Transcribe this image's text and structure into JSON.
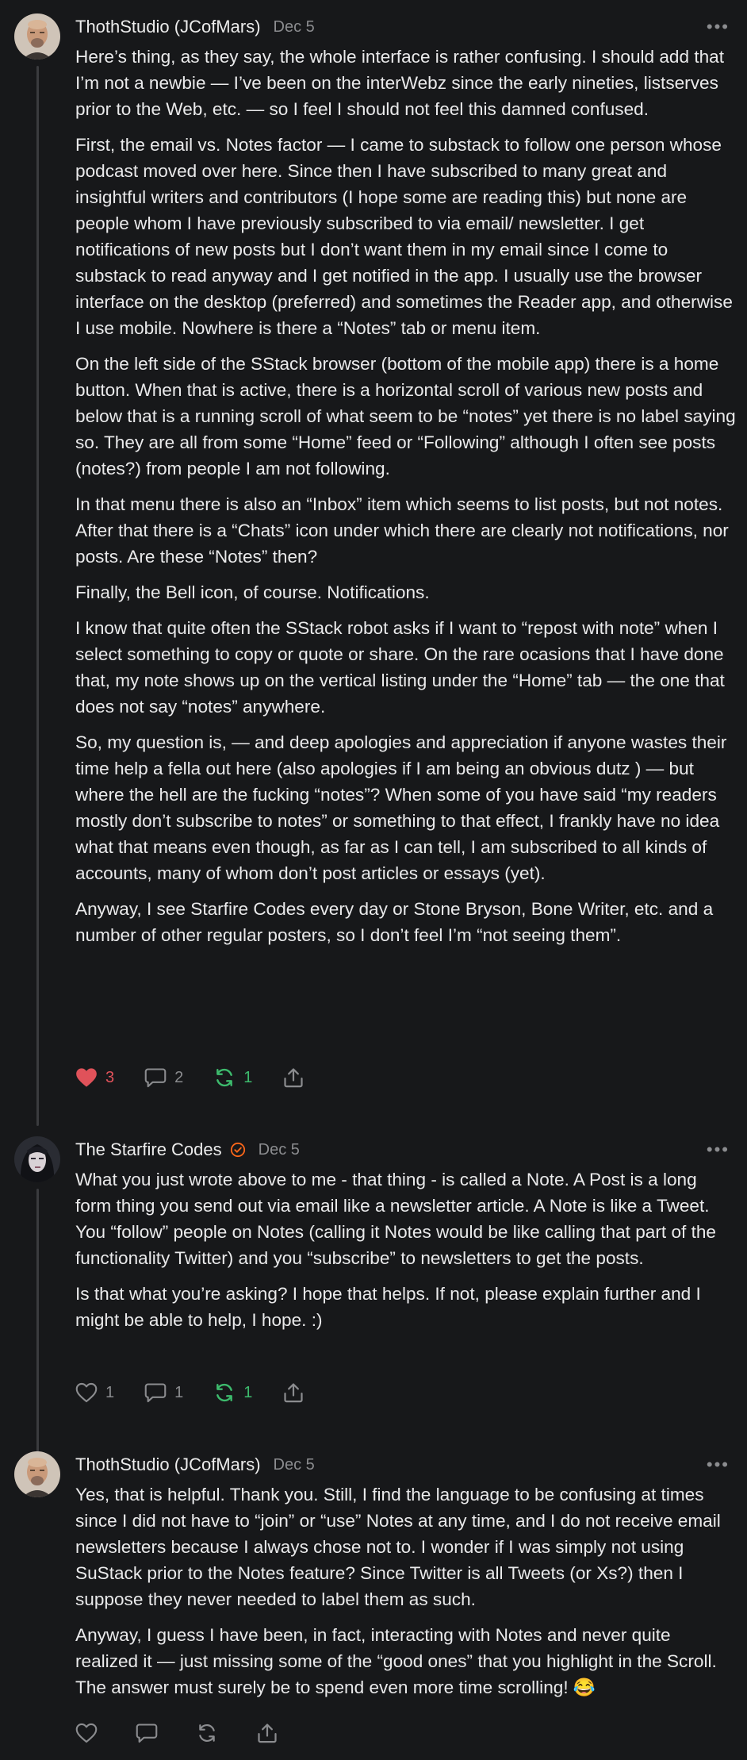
{
  "notes": [
    {
      "author": "ThothStudio (JCofMars)",
      "date": "Dec 5",
      "verified": false,
      "paragraphs": [
        "Here’s thing, as they say, the whole interface is rather confusing. I should add that I’m not a newbie — I’ve been on the interWebz since the early nineties, listserves prior to the Web, etc. — so I feel I should not feel this damned confused.",
        "First, the email vs. Notes factor — I came to substack to follow one person whose podcast moved over here. Since then I have subscribed to many great and insightful writers and contributors (I hope some are reading this) but none are people whom I have previously subscribed to via email/ newsletter. I get notifications of new posts but I don’t want them in my email since I come to substack to read anyway and I get notified in the app. I usually use the browser interface on the desktop (preferred) and sometimes the Reader app, and otherwise I use mobile. Nowhere is there a “Notes” tab or menu item.",
        "On the left side of the SStack browser (bottom of the mobile app) there is a home button. When that is active, there is a horizontal scroll of various new posts and below that is a running scroll of what seem to be “notes” yet there is no label saying so. They are all from some “Home” feed or “Following” although I often see posts (notes?) from people I am not following.",
        "In that menu there is also an “Inbox” item which seems to list posts, but not notes. After that there is a “Chats” icon under which there are clearly not notifications, nor posts. Are these “Notes” then?",
        "Finally, the Bell icon, of course. Notifications.",
        "I know that quite often the SStack robot asks if I want to “repost with note” when I select something to copy or quote or share. On the rare ocasions that I have done that, my note shows up on the vertical listing under the “Home” tab — the one that does not say “notes” anywhere.",
        "So, my question is, — and deep apologies and appreciation if anyone wastes their time help a fella out here (also apologies if I am being an obvious dutz ) — but where the hell are the fucking “notes”? When some of you have said “my readers mostly don’t subscribe to notes” or something to that effect, I frankly have no idea what that means even though, as far as I can tell, I am subscribed to all kinds of accounts, many of whom don’t post articles or essays (yet).",
        "Anyway, I see Starfire Codes every day or Stone Bryson, Bone Writer, etc. and a number of other regular posters, so I don’t feel I’m “not seeing them”."
      ],
      "likes": "3",
      "comments": "2",
      "restacks": "1",
      "liked": true,
      "restacked": true
    },
    {
      "author": "The Starfire Codes",
      "date": "Dec 5",
      "verified": true,
      "paragraphs": [
        "What you just wrote above to me - that thing - is called a Note. A Post is a long form thing you send out via email like a newsletter article. A Note is like a Tweet. You “follow” people on Notes (calling it Notes would be like calling that part of the functionality Twitter) and you “subscribe” to newsletters to get the posts.",
        "Is that what you’re asking? I hope that helps. If not, please explain further and I might be able to help, I hope. :)"
      ],
      "likes": "1",
      "comments": "1",
      "restacks": "1",
      "liked": false,
      "restacked": true
    },
    {
      "author": "ThothStudio (JCofMars)",
      "date": "Dec 5",
      "verified": false,
      "paragraphs": [
        "Yes, that is helpful. Thank you. Still, I find the language to be confusing at times since I did not have to “join” or “use” Notes at any time, and I do not receive email newsletters because I always chose not to. I wonder if I was simply not using SuStack prior to the Notes feature? Since Twitter is all Tweets (or Xs?) then I suppose they never needed to label them as such.",
        "Anyway, I guess I have been, in fact, interacting with Notes and never quite realized it — just missing some of the “good ones” that you highlight in the Scroll. The answer must surely be to spend even more time scrolling! 😂"
      ],
      "likes": "",
      "comments": "",
      "restacks": "",
      "liked": false,
      "restacked": false
    }
  ],
  "icons": {
    "more": "more-horizontal-icon",
    "like": "heart-icon",
    "comment": "comment-icon",
    "restack": "restack-icon",
    "share": "share-icon",
    "verified": "verified-badge-icon"
  },
  "colors": {
    "background": "#17181a",
    "like_active": "#e0525a",
    "restack_active": "#3dbb6d",
    "verified": "#ff6719",
    "muted": "#8b8c8f"
  }
}
